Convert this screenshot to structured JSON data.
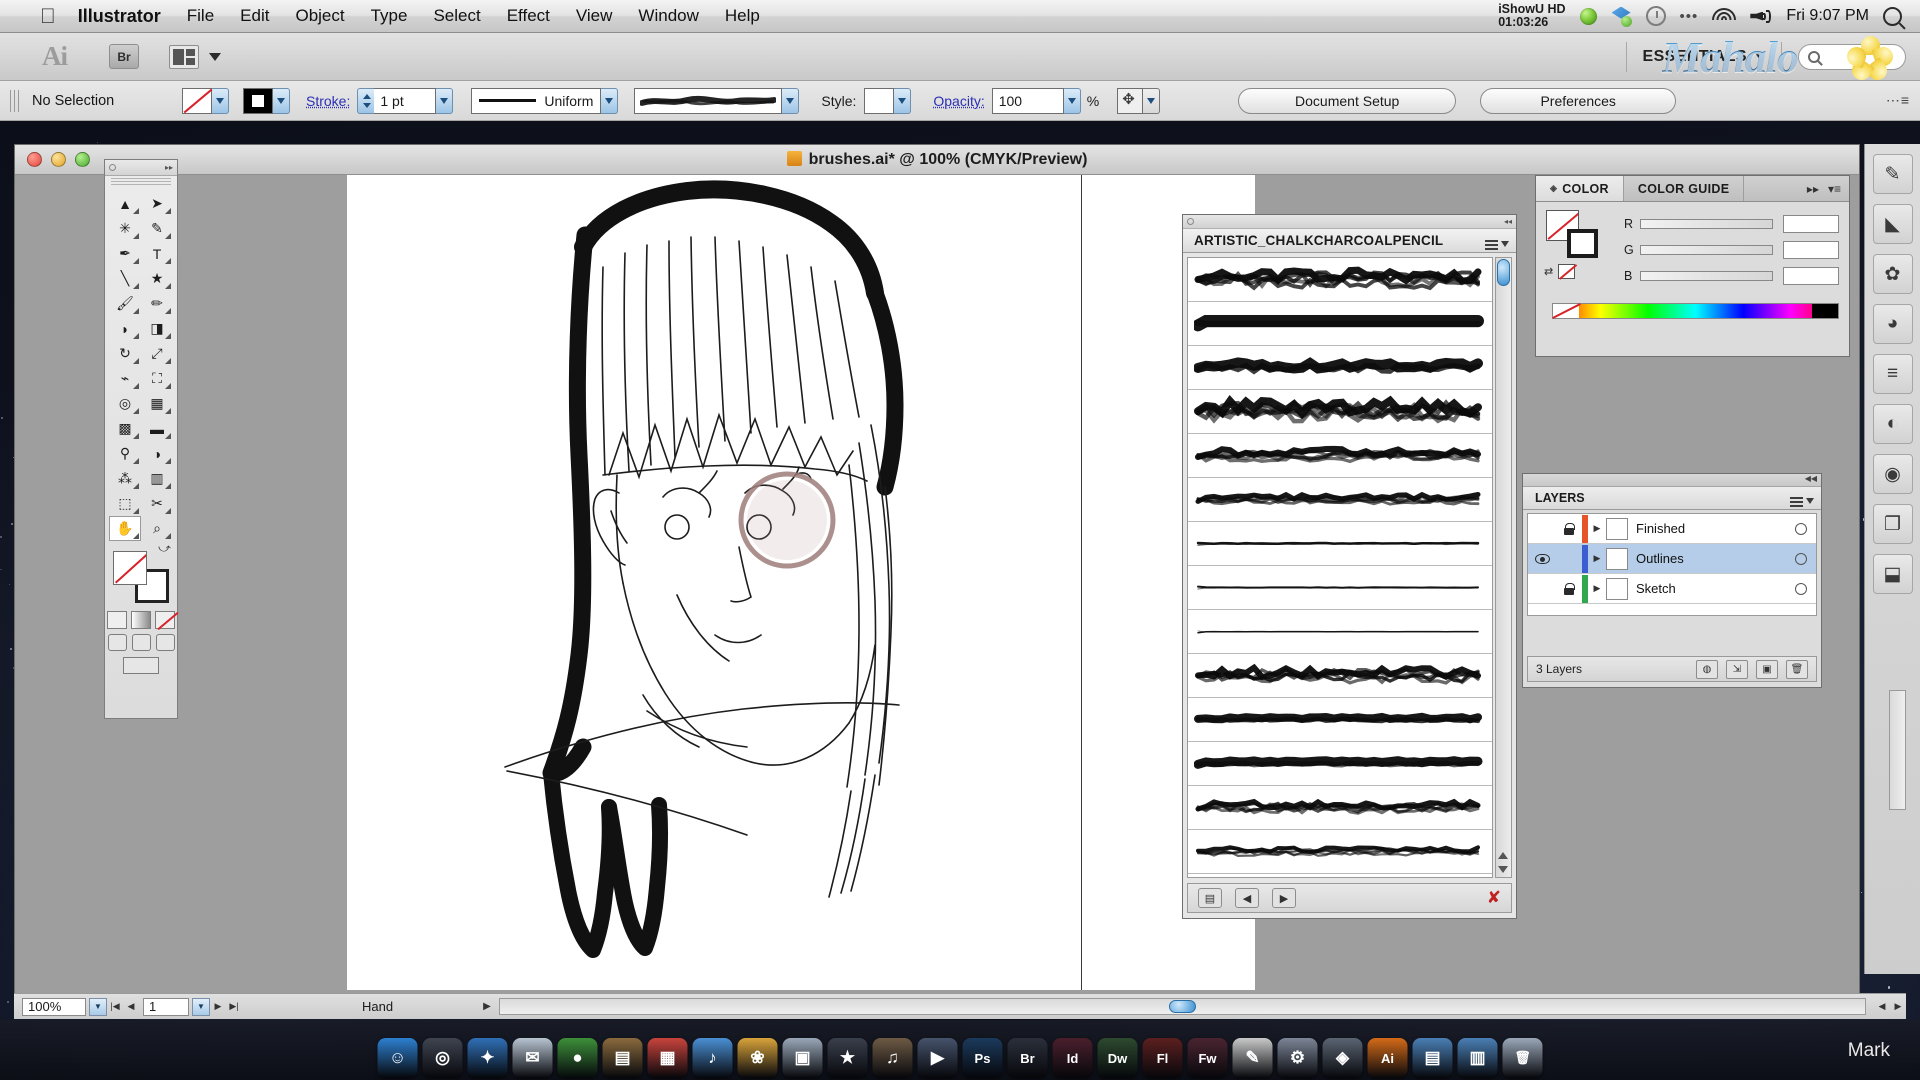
{
  "menubar": {
    "apple_icon": "apple-logo",
    "app_name": "Illustrator",
    "items": [
      "File",
      "Edit",
      "Object",
      "Type",
      "Select",
      "Effect",
      "View",
      "Window",
      "Help"
    ],
    "status": {
      "ishowu_label": "iShowU HD",
      "ishowu_time": "01:03:26",
      "icons": [
        "green-status-dot",
        "dropbox-icon",
        "time-machine-icon",
        "ellipsis-icon",
        "wifi-icon",
        "volume-icon"
      ],
      "clock": "Fri 9:07 PM",
      "spotlight": "search-icon"
    }
  },
  "app_toolbar": {
    "logo": "Ai",
    "bridge_button": "Br",
    "arrange_documents": "arrange-documents-icon",
    "workspace": "ESSENTIALS",
    "search_placeholder": "",
    "watermark": "Mahalo"
  },
  "control_bar": {
    "selection_status": "No Selection",
    "fill_label": "fill-none",
    "stroke_color_label": "stroke-black",
    "stroke_label": "Stroke:",
    "stroke_weight": "1 pt",
    "stroke_profile": "Uniform",
    "brush_definition": "chalk-brush-preview",
    "style_label": "Style:",
    "style_value": "",
    "opacity_label": "Opacity:",
    "opacity_value": "100",
    "opacity_unit": "%",
    "transform_icon": "transform-icon",
    "document_setup": "Document Setup",
    "preferences": "Preferences",
    "panel_menu": "panel-menu-icon"
  },
  "document": {
    "title": "brushes.ai* @ 100% (CMYK/Preview)",
    "traffic_lights": [
      "close",
      "minimize",
      "zoom"
    ]
  },
  "tools": {
    "rows": [
      [
        "selection-tool",
        "direct-selection-tool"
      ],
      [
        "magic-wand-tool",
        "lasso-tool"
      ],
      [
        "pen-tool",
        "type-tool"
      ],
      [
        "line-segment-tool",
        "star-tool"
      ],
      [
        "paintbrush-tool",
        "pencil-tool"
      ],
      [
        "blob-brush-tool",
        "eraser-tool"
      ],
      [
        "rotate-tool",
        "scale-tool"
      ],
      [
        "width-tool",
        "free-transform-tool"
      ],
      [
        "shape-builder-tool",
        "perspective-grid-tool"
      ],
      [
        "mesh-tool",
        "gradient-tool"
      ],
      [
        "eyedropper-tool",
        "blend-tool"
      ],
      [
        "symbol-sprayer-tool",
        "column-graph-tool"
      ],
      [
        "artboard-tool",
        "slice-tool"
      ],
      [
        "hand-tool",
        "zoom-tool"
      ]
    ],
    "fill_stroke": "fill-stroke-indicator",
    "fill_stroke_swap": "swap-fill-stroke-icon",
    "color_modes": [
      "color-swatch-mode",
      "gradient-mode",
      "none-mode"
    ],
    "draw_modes": [
      "draw-normal",
      "draw-behind",
      "draw-inside"
    ],
    "screen_mode": "change-screen-mode"
  },
  "brushes_panel": {
    "tab_title": "ARTISTIC_CHALKCHARCOALPENCIL",
    "menu_icon": "panel-menu-icon",
    "brush_count": 16,
    "footer_buttons": [
      "brush-libraries-menu",
      "previous-brush-library",
      "next-brush-library"
    ],
    "delete_icon": "delete-brush-icon",
    "scrollbar": "vertical-scrollbar"
  },
  "color_panel": {
    "tabs": [
      {
        "label": "COLOR",
        "active": true
      },
      {
        "label": "COLOR GUIDE",
        "active": false
      }
    ],
    "collapse_icon": "collapse-panel-icon",
    "menu_icon": "panel-menu-icon",
    "sliders": [
      {
        "label": "R",
        "value": ""
      },
      {
        "label": "G",
        "value": ""
      },
      {
        "label": "B",
        "value": ""
      }
    ],
    "none_swatch": "none-color-swatch",
    "spectrum": "color-spectrum-ramp"
  },
  "layers_panel": {
    "tab_title": "LAYERS",
    "rows": [
      {
        "name": "Finished",
        "visible": false,
        "locked": true,
        "color": "#e8542a",
        "selected": false
      },
      {
        "name": "Outlines",
        "visible": true,
        "locked": false,
        "color": "#3b5fd0",
        "selected": true
      },
      {
        "name": "Sketch",
        "visible": false,
        "locked": true,
        "color": "#2fa84f",
        "selected": false
      }
    ],
    "footer_count": "3 Layers",
    "footer_buttons": [
      "make-clipping-mask",
      "create-new-sublayer",
      "create-new-layer",
      "delete-selection"
    ]
  },
  "right_dock": {
    "items": [
      "brushes-icon",
      "symbols-icon",
      "graphic-styles-icon",
      "appearance-icon",
      "align-icon",
      "transparency-icon",
      "stroke-icon",
      "pathfinder-icon",
      "artboards-icon"
    ]
  },
  "status_bar": {
    "zoom": "100%",
    "page": "1",
    "tool_name": "Hand",
    "nav_first": "first-page-icon",
    "nav_prev": "previous-page-icon",
    "nav_next": "next-page-icon",
    "nav_last": "last-page-icon"
  },
  "dock": {
    "user_label": "Mark",
    "icons": [
      {
        "name": "finder-icon",
        "glyph": "☺",
        "color": "#2d7fd0"
      },
      {
        "name": "dashboard-icon",
        "glyph": "◎",
        "color": "#3f4450"
      },
      {
        "name": "safari-icon",
        "glyph": "✦",
        "color": "#2f6fb5"
      },
      {
        "name": "mail-icon",
        "glyph": "✉",
        "color": "#b8c4d2"
      },
      {
        "name": "ichat-icon",
        "glyph": "●",
        "color": "#3d8f3a"
      },
      {
        "name": "address-book-icon",
        "glyph": "▤",
        "color": "#8a6a3e"
      },
      {
        "name": "ical-icon",
        "glyph": "▦",
        "color": "#c9433c"
      },
      {
        "name": "itunes-icon",
        "glyph": "♪",
        "color": "#4a8fd4"
      },
      {
        "name": "iphoto-icon",
        "glyph": "❀",
        "color": "#d9a33a"
      },
      {
        "name": "preview-icon",
        "glyph": "▣",
        "color": "#9aa7b8"
      },
      {
        "name": "imovie-icon",
        "glyph": "★",
        "color": "#3a3f4c"
      },
      {
        "name": "garageband-icon",
        "glyph": "♫",
        "color": "#6d5a44"
      },
      {
        "name": "quicktime-icon",
        "glyph": "▶",
        "color": "#46536b"
      },
      {
        "name": "photoshop-icon",
        "glyph": "Ps",
        "color": "#1b3a5c"
      },
      {
        "name": "bridge-icon",
        "glyph": "Br",
        "color": "#2a2f3a"
      },
      {
        "name": "indesign-icon",
        "glyph": "Id",
        "color": "#4a1f2c"
      },
      {
        "name": "dreamweaver-icon",
        "glyph": "Dw",
        "color": "#2d4a2f"
      },
      {
        "name": "flash-icon",
        "glyph": "Fl",
        "color": "#5c1f1f"
      },
      {
        "name": "fireworks-icon",
        "glyph": "Fw",
        "color": "#4a2430"
      },
      {
        "name": "textedit-icon",
        "glyph": "✎",
        "color": "#c9c9c9"
      },
      {
        "name": "system-prefs-icon",
        "glyph": "⚙",
        "color": "#7c8596"
      },
      {
        "name": "utilities-icon",
        "glyph": "◈",
        "color": "#5a6472"
      },
      {
        "name": "illustrator-icon",
        "glyph": "Ai",
        "color": "#d46a18"
      },
      {
        "name": "documents-folder-icon",
        "glyph": "▤",
        "color": "#4a7fb5"
      },
      {
        "name": "downloads-folder-icon",
        "glyph": "▥",
        "color": "#4a7fb5"
      },
      {
        "name": "trash-icon",
        "glyph": "🗑",
        "color": "#9aa7b8"
      }
    ]
  }
}
